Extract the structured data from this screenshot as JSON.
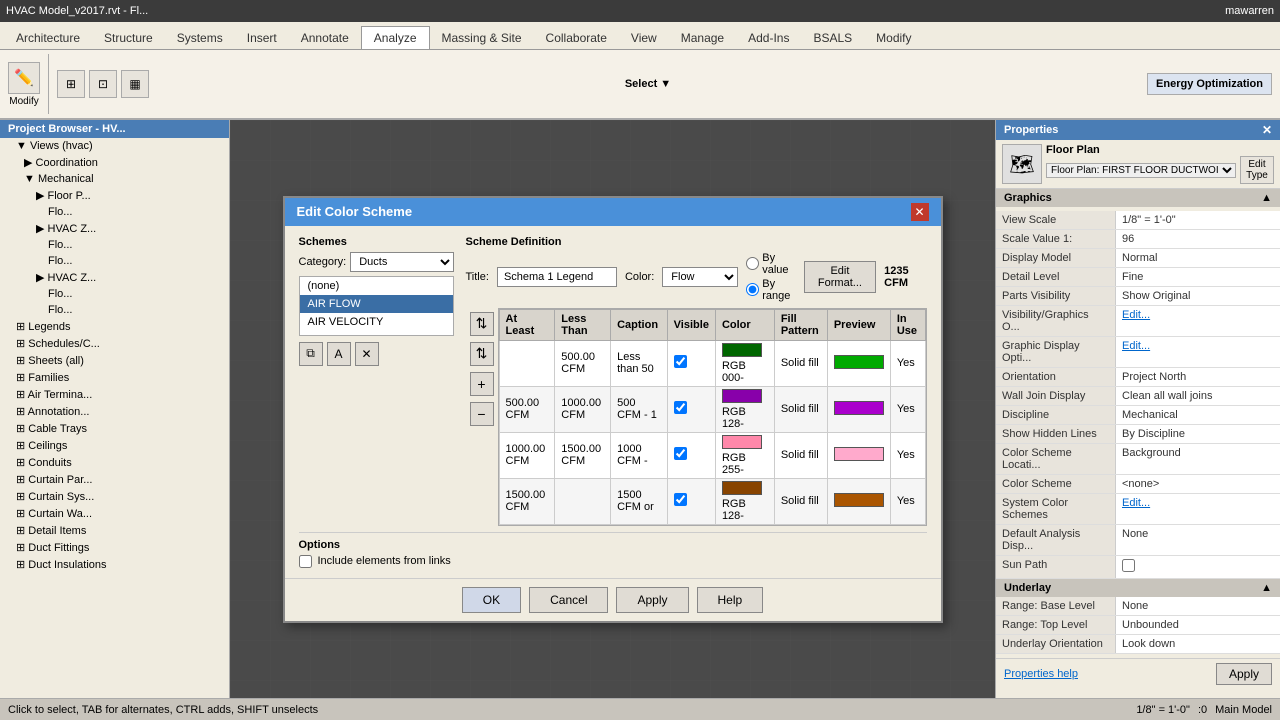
{
  "app": {
    "title": "HVAC Model_v2017.rvt - Fl...",
    "window_title": "Edit Color Scheme"
  },
  "top_bar": {
    "title": "HVAC Model_v2017.rvt - Fl...",
    "user": "mawarren"
  },
  "ribbon_tabs": [
    {
      "label": "Architecture",
      "active": false
    },
    {
      "label": "Structure",
      "active": false
    },
    {
      "label": "Systems",
      "active": false
    },
    {
      "label": "Insert",
      "active": false
    },
    {
      "label": "Annotate",
      "active": false
    },
    {
      "label": "Analyze",
      "active": true
    },
    {
      "label": "Massing & Site",
      "active": false
    },
    {
      "label": "Collaborate",
      "active": false
    },
    {
      "label": "View",
      "active": false
    },
    {
      "label": "Manage",
      "active": false
    },
    {
      "label": "Add-Ins",
      "active": false
    },
    {
      "label": "BSALS",
      "active": false
    },
    {
      "label": "Modify",
      "active": false
    }
  ],
  "left_panel": {
    "header": "Project Browser - HV...",
    "items": [
      {
        "label": "Views (hvac)",
        "indent": 0,
        "has_arrow": true
      },
      {
        "label": "Coordination",
        "indent": 1,
        "has_arrow": true
      },
      {
        "label": "Mechanical",
        "indent": 1,
        "has_arrow": true
      },
      {
        "label": "Floor P...",
        "indent": 2,
        "has_arrow": true
      },
      {
        "label": "Flo...",
        "indent": 3
      },
      {
        "label": "HVAC Z...",
        "indent": 2,
        "has_arrow": true
      },
      {
        "label": "Flo...",
        "indent": 3
      },
      {
        "label": "Flo...",
        "indent": 3
      },
      {
        "label": "HVAC Z...",
        "indent": 2,
        "has_arrow": true
      },
      {
        "label": "Flo...",
        "indent": 3
      },
      {
        "label": "Flo...",
        "indent": 3
      },
      {
        "label": "Legends",
        "indent": 0
      },
      {
        "label": "Schedules/C...",
        "indent": 0
      },
      {
        "label": "Sheets (all)",
        "indent": 0
      },
      {
        "label": "Families",
        "indent": 0
      },
      {
        "label": "Air Termina...",
        "indent": 0
      },
      {
        "label": "Annotation...",
        "indent": 0
      },
      {
        "label": "Cable Trays",
        "indent": 0
      },
      {
        "label": "Ceilings",
        "indent": 0
      },
      {
        "label": "Conduits",
        "indent": 0
      },
      {
        "label": "Curtain Par...",
        "indent": 0
      },
      {
        "label": "Curtain Sys...",
        "indent": 0
      },
      {
        "label": "Curtain Wa...",
        "indent": 0
      },
      {
        "label": "Detail Items",
        "indent": 0
      },
      {
        "label": "Duct Fittings",
        "indent": 0
      },
      {
        "label": "Duct Insulations",
        "indent": 0
      }
    ]
  },
  "dialog": {
    "title": "Edit Color Scheme",
    "schemes_label": "Schemes",
    "category_label": "Category:",
    "category_value": "Ducts",
    "scheme_list": [
      {
        "label": "(none)",
        "selected": false
      },
      {
        "label": "AIR FLOW",
        "selected": true
      },
      {
        "label": "AIR VELOCITY",
        "selected": false
      }
    ],
    "scheme_definition_label": "Scheme Definition",
    "title_label": "Title:",
    "title_value": "Schema 1 Legend",
    "color_label": "Color:",
    "color_value": "Flow",
    "by_value_label": "By value",
    "by_range_label": "By range",
    "edit_format_label": "Edit Format...",
    "cfm_value": "1235 CFM",
    "table": {
      "headers": [
        "At Least",
        "Less Than",
        "Caption",
        "Visible",
        "Color",
        "Fill Pattern",
        "Preview",
        "In Use"
      ],
      "rows": [
        {
          "at_least": "",
          "less_than": "500.00 CFM",
          "caption": "Less than 50",
          "visible": true,
          "color": "RGB 000-",
          "color_hex": "#006600",
          "fill_pattern": "Solid fill",
          "preview_hex": "#00aa00",
          "in_use": "Yes"
        },
        {
          "at_least": "500.00 CFM",
          "less_than": "1000.00 CFM",
          "caption": "500 CFM - 1",
          "visible": true,
          "color": "RGB 128-",
          "color_hex": "#8800aa",
          "fill_pattern": "Solid fill",
          "preview_hex": "#aa00cc",
          "in_use": "Yes"
        },
        {
          "at_least": "1000.00 CFM",
          "less_than": "1500.00 CFM",
          "caption": "1000 CFM -",
          "visible": true,
          "color": "RGB 255-",
          "color_hex": "#ff88aa",
          "fill_pattern": "Solid fill",
          "preview_hex": "#ffaacc",
          "in_use": "Yes"
        },
        {
          "at_least": "1500.00 CFM",
          "less_than": "",
          "caption": "1500 CFM or",
          "visible": true,
          "color": "RGB 128-",
          "color_hex": "#884400",
          "fill_pattern": "Solid fill",
          "preview_hex": "#aa5500",
          "in_use": "Yes"
        }
      ]
    },
    "options_label": "Options",
    "include_elements_label": "Include elements from links",
    "include_elements_checked": false,
    "buttons": {
      "ok": "OK",
      "cancel": "Cancel",
      "apply": "Apply",
      "help": "Help"
    },
    "footer_icons": [
      "copy-icon",
      "rename-icon",
      "delete-icon"
    ]
  },
  "right_panel": {
    "header": "Properties",
    "floor_plan_label": "Floor Plan",
    "floor_plan_selector": "Floor Plan: FIRST FLOOR DUCTWOI",
    "edit_type_label": "Edit Type",
    "graphics_label": "Graphics",
    "properties": [
      {
        "label": "View Scale",
        "value": "1/8\" = 1'-0\""
      },
      {
        "label": "Scale Value  1:",
        "value": "96"
      },
      {
        "label": "Display Model",
        "value": "Normal"
      },
      {
        "label": "Detail Level",
        "value": "Fine"
      },
      {
        "label": "Parts Visibility",
        "value": "Show Original"
      },
      {
        "label": "Visibility/Graphics O...",
        "value": "Edit..."
      },
      {
        "label": "Graphic Display Opti...",
        "value": "Edit..."
      },
      {
        "label": "Orientation",
        "value": "Project North"
      },
      {
        "label": "Wall Join Display",
        "value": "Clean all wall joins"
      },
      {
        "label": "Discipline",
        "value": "Mechanical"
      },
      {
        "label": "Show Hidden Lines",
        "value": "By Discipline"
      },
      {
        "label": "Color Scheme Locati...",
        "value": "Background"
      },
      {
        "label": "Color Scheme",
        "value": "<none>"
      },
      {
        "label": "System Color Schemes",
        "value": "Edit..."
      },
      {
        "label": "Default Analysis Disp...",
        "value": "None"
      },
      {
        "label": "Sun Path",
        "value": ""
      },
      {
        "label": "Underlay",
        "value": ""
      },
      {
        "label": "Range: Base Level",
        "value": "None"
      },
      {
        "label": "Range: Top Level",
        "value": "Unbounded"
      },
      {
        "label": "Underlay Orientation",
        "value": "Look down"
      }
    ],
    "properties_help": "Properties help",
    "apply_label": "Apply"
  },
  "status_bar": {
    "message": "Click to select, TAB for alternates, CTRL adds, SHIFT unselects",
    "scale": "1/8\" = 1'-0\"",
    "model": "Main Model",
    "coords": ":0"
  }
}
